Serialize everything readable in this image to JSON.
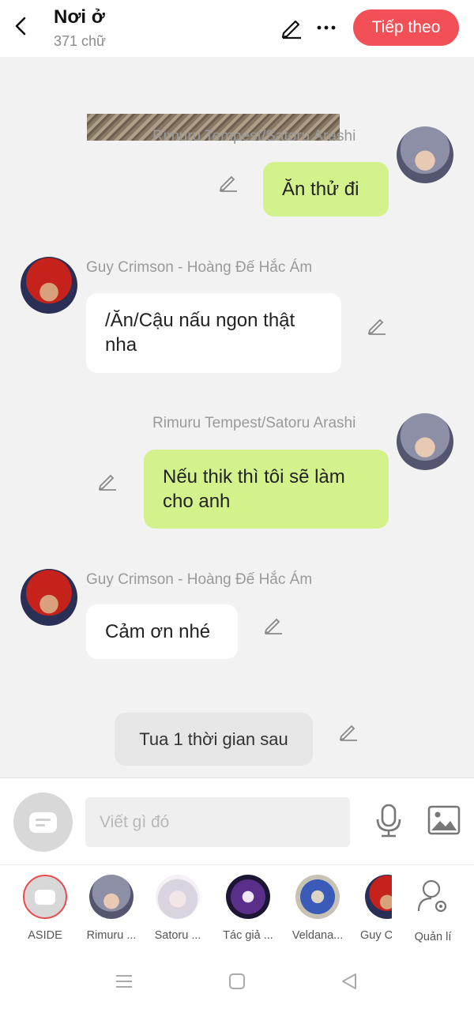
{
  "header": {
    "title": "Nơi ở",
    "word_count": "371 chữ",
    "next_label": "Tiếp theo"
  },
  "messages": [
    {
      "sender": "Rimuru Tempest/Satoru Arashi",
      "text": "Ăn thử đi",
      "side": "right"
    },
    {
      "sender": "Guy Crimson - Hoàng Đế Hắc Ám",
      "text": "/Ăn/Cậu nấu ngon thật nha",
      "side": "left"
    },
    {
      "sender": "Rimuru Tempest/Satoru Arashi",
      "text": "Nếu thik thì tôi sẽ làm cho anh",
      "side": "right"
    },
    {
      "sender": "Guy Crimson - Hoàng Đế Hắc Ám",
      "text": "Cảm ơn nhé",
      "side": "left"
    }
  ],
  "narration": "Tua 1 thời gian sau",
  "composer": {
    "placeholder": "Viết gì đó"
  },
  "characters": [
    "ASIDE",
    "Rimuru ...",
    "Satoru ...",
    "Tác giả ...",
    "Veldana...",
    "Guy C",
    "Quản lí"
  ],
  "colors": {
    "accent": "#f25056",
    "my_bubble": "#d4f28c",
    "their_bubble": "#ffffff"
  }
}
